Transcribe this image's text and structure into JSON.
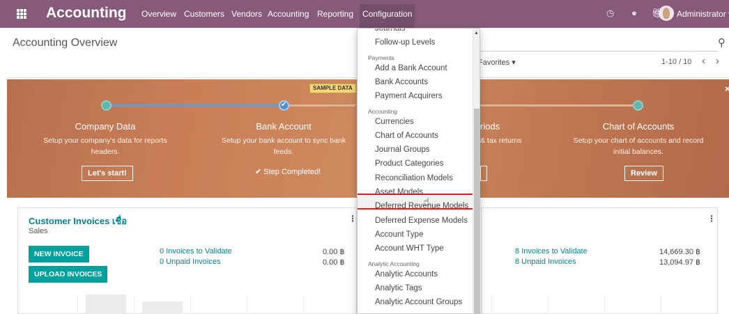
{
  "navbar": {
    "brand": "Accounting",
    "menu": [
      {
        "label": "Overview"
      },
      {
        "label": "Customers"
      },
      {
        "label": "Vendors"
      },
      {
        "label": "Accounting"
      },
      {
        "label": "Reporting"
      },
      {
        "label": "Configuration",
        "active": true
      }
    ],
    "user": "Administrator ▾",
    "accent": "#875a7b"
  },
  "control_panel": {
    "title": "Accounting Overview",
    "favorites": "Favorites ▾",
    "pager": "1-10 / 10",
    "prev": "‹",
    "next": "›"
  },
  "onboarding": {
    "steps": [
      {
        "title": "Company Data",
        "desc": "Setup your company's data for reports headers.",
        "button": "Let's start!"
      },
      {
        "title": "Bank Account",
        "desc": "Setup your bank account to sync bank feeds.",
        "status": "✔ Step Completed!"
      },
      {
        "title": "riods",
        "desc": "& tax returns"
      },
      {
        "title": "Chart of Accounts",
        "desc": "Setup your chart of accounts and record initial balances.",
        "button": "Review"
      }
    ],
    "close": "×"
  },
  "cards": {
    "customer_invoices": {
      "title": "Customer Invoices เชื่อ",
      "subtitle": "Sales",
      "new_invoice": "NEW INVOICE",
      "upload_invoices": "UPLOAD INVOICES",
      "to_validate": "0 Invoices to Validate",
      "unpaid": "0 Unpaid Invoices",
      "to_validate_amount": "0.00 ฿",
      "unpaid_amount": "0.00 ฿",
      "sample_badge": "SAMPLE DATA"
    },
    "vendor_bills": {
      "to_validate": "8 Invoices to Validate",
      "unpaid": "8 Unpaid Invoices",
      "to_validate_amount": "14,669.30 ฿",
      "unpaid_amount": "13,094.97 ฿"
    }
  },
  "dropdown": {
    "items": [
      {
        "kind": "item",
        "label": "Journals"
      },
      {
        "kind": "item",
        "label": "Follow-up Levels"
      },
      {
        "kind": "header",
        "label": "Payments"
      },
      {
        "kind": "item",
        "label": "Add a Bank Account"
      },
      {
        "kind": "item",
        "label": "Bank Accounts"
      },
      {
        "kind": "item",
        "label": "Payment Acquirers"
      },
      {
        "kind": "header",
        "label": "Accounting"
      },
      {
        "kind": "item",
        "label": "Currencies"
      },
      {
        "kind": "item",
        "label": "Chart of Accounts"
      },
      {
        "kind": "item",
        "label": "Journal Groups"
      },
      {
        "kind": "item",
        "label": "Product Categories"
      },
      {
        "kind": "item",
        "label": "Reconciliation Models"
      },
      {
        "kind": "item",
        "label": "Asset Models",
        "highlighted": true
      },
      {
        "kind": "item",
        "label": "Deferred Revenue Models"
      },
      {
        "kind": "item",
        "label": "Deferred Expense Models"
      },
      {
        "kind": "item",
        "label": "Account Type"
      },
      {
        "kind": "item",
        "label": "Account WHT Type"
      },
      {
        "kind": "header",
        "label": "Analytic Accounting"
      },
      {
        "kind": "item",
        "label": "Analytic Accounts"
      },
      {
        "kind": "item",
        "label": "Analytic Tags"
      },
      {
        "kind": "item",
        "label": "Analytic Account Groups"
      }
    ],
    "highlight_color": "#e01b24"
  }
}
